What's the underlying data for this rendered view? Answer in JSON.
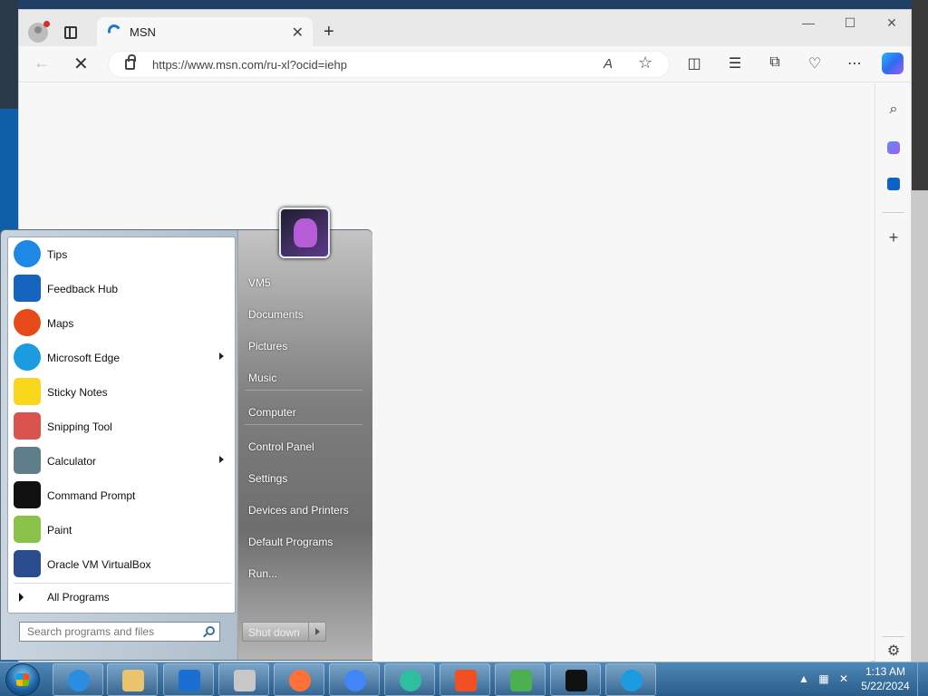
{
  "browser": {
    "tab_title": "MSN",
    "tab_close": "✕",
    "new_tab": "+",
    "win_min": "—",
    "win_max": "☐",
    "win_close": "✕",
    "back": "←",
    "stop": "✕",
    "url": "https://www.msn.com/ru-xl?ocid=iehp",
    "read_aloud": "A",
    "favorite": "☆",
    "more": "⋯",
    "accent": "#1a7ad3"
  },
  "sidebar": {
    "search": "⌕",
    "add": "+"
  },
  "start_menu": {
    "programs": [
      {
        "label": "Tips",
        "icon": "lightbulb-icon",
        "color": "#1e88e5",
        "arrow": false
      },
      {
        "label": "Feedback Hub",
        "icon": "feedback-icon",
        "color": "#1565c0",
        "arrow": false
      },
      {
        "label": "Maps",
        "icon": "map-pin-icon",
        "color": "#e64a19",
        "arrow": false
      },
      {
        "label": "Microsoft Edge",
        "icon": "edge-icon",
        "color": "#1b9be0",
        "arrow": true
      },
      {
        "label": "Sticky Notes",
        "icon": "sticky-note-icon",
        "color": "#f9d71c",
        "arrow": false
      },
      {
        "label": "Snipping Tool",
        "icon": "scissors-icon",
        "color": "#d9534f",
        "arrow": false
      },
      {
        "label": "Calculator",
        "icon": "calculator-icon",
        "color": "#607d8b",
        "arrow": true
      },
      {
        "label": "Command Prompt",
        "icon": "terminal-icon",
        "color": "#111111",
        "arrow": false
      },
      {
        "label": "Paint",
        "icon": "palette-icon",
        "color": "#8bc34a",
        "arrow": false
      },
      {
        "label": "Oracle VM VirtualBox",
        "icon": "virtualbox-icon",
        "color": "#2a4d8f",
        "arrow": false
      }
    ],
    "all_programs": "All Programs",
    "search_placeholder": "Search programs and files",
    "places": [
      "VM5",
      "Documents",
      "Pictures",
      "Music",
      "Computer",
      "Control Panel",
      "Settings",
      "Devices and Printers",
      "Default Programs",
      "Run..."
    ],
    "shutdown": "Shut down"
  },
  "taskbar": {
    "time": "1:13 AM",
    "date": "5/22/2024",
    "apps": [
      {
        "name": "internet-explorer-icon",
        "color": "#2b8de0"
      },
      {
        "name": "file-explorer-icon",
        "color": "#e9c46a"
      },
      {
        "name": "store-icon",
        "color": "#1b6fd1"
      },
      {
        "name": "network-monitor-icon",
        "color": "#c7c7c7"
      },
      {
        "name": "firefox-icon",
        "color": "#ff7139"
      },
      {
        "name": "chrome-icon",
        "color": "#4285f4"
      },
      {
        "name": "browser-globe-icon",
        "color": "#2fbf9f"
      },
      {
        "name": "windows-flag-icon",
        "color": "#f25022"
      },
      {
        "name": "download-tool-icon",
        "color": "#4caf50"
      },
      {
        "name": "7zip-icon",
        "color": "#111111"
      },
      {
        "name": "edge-icon",
        "color": "#1b9be0"
      }
    ]
  }
}
